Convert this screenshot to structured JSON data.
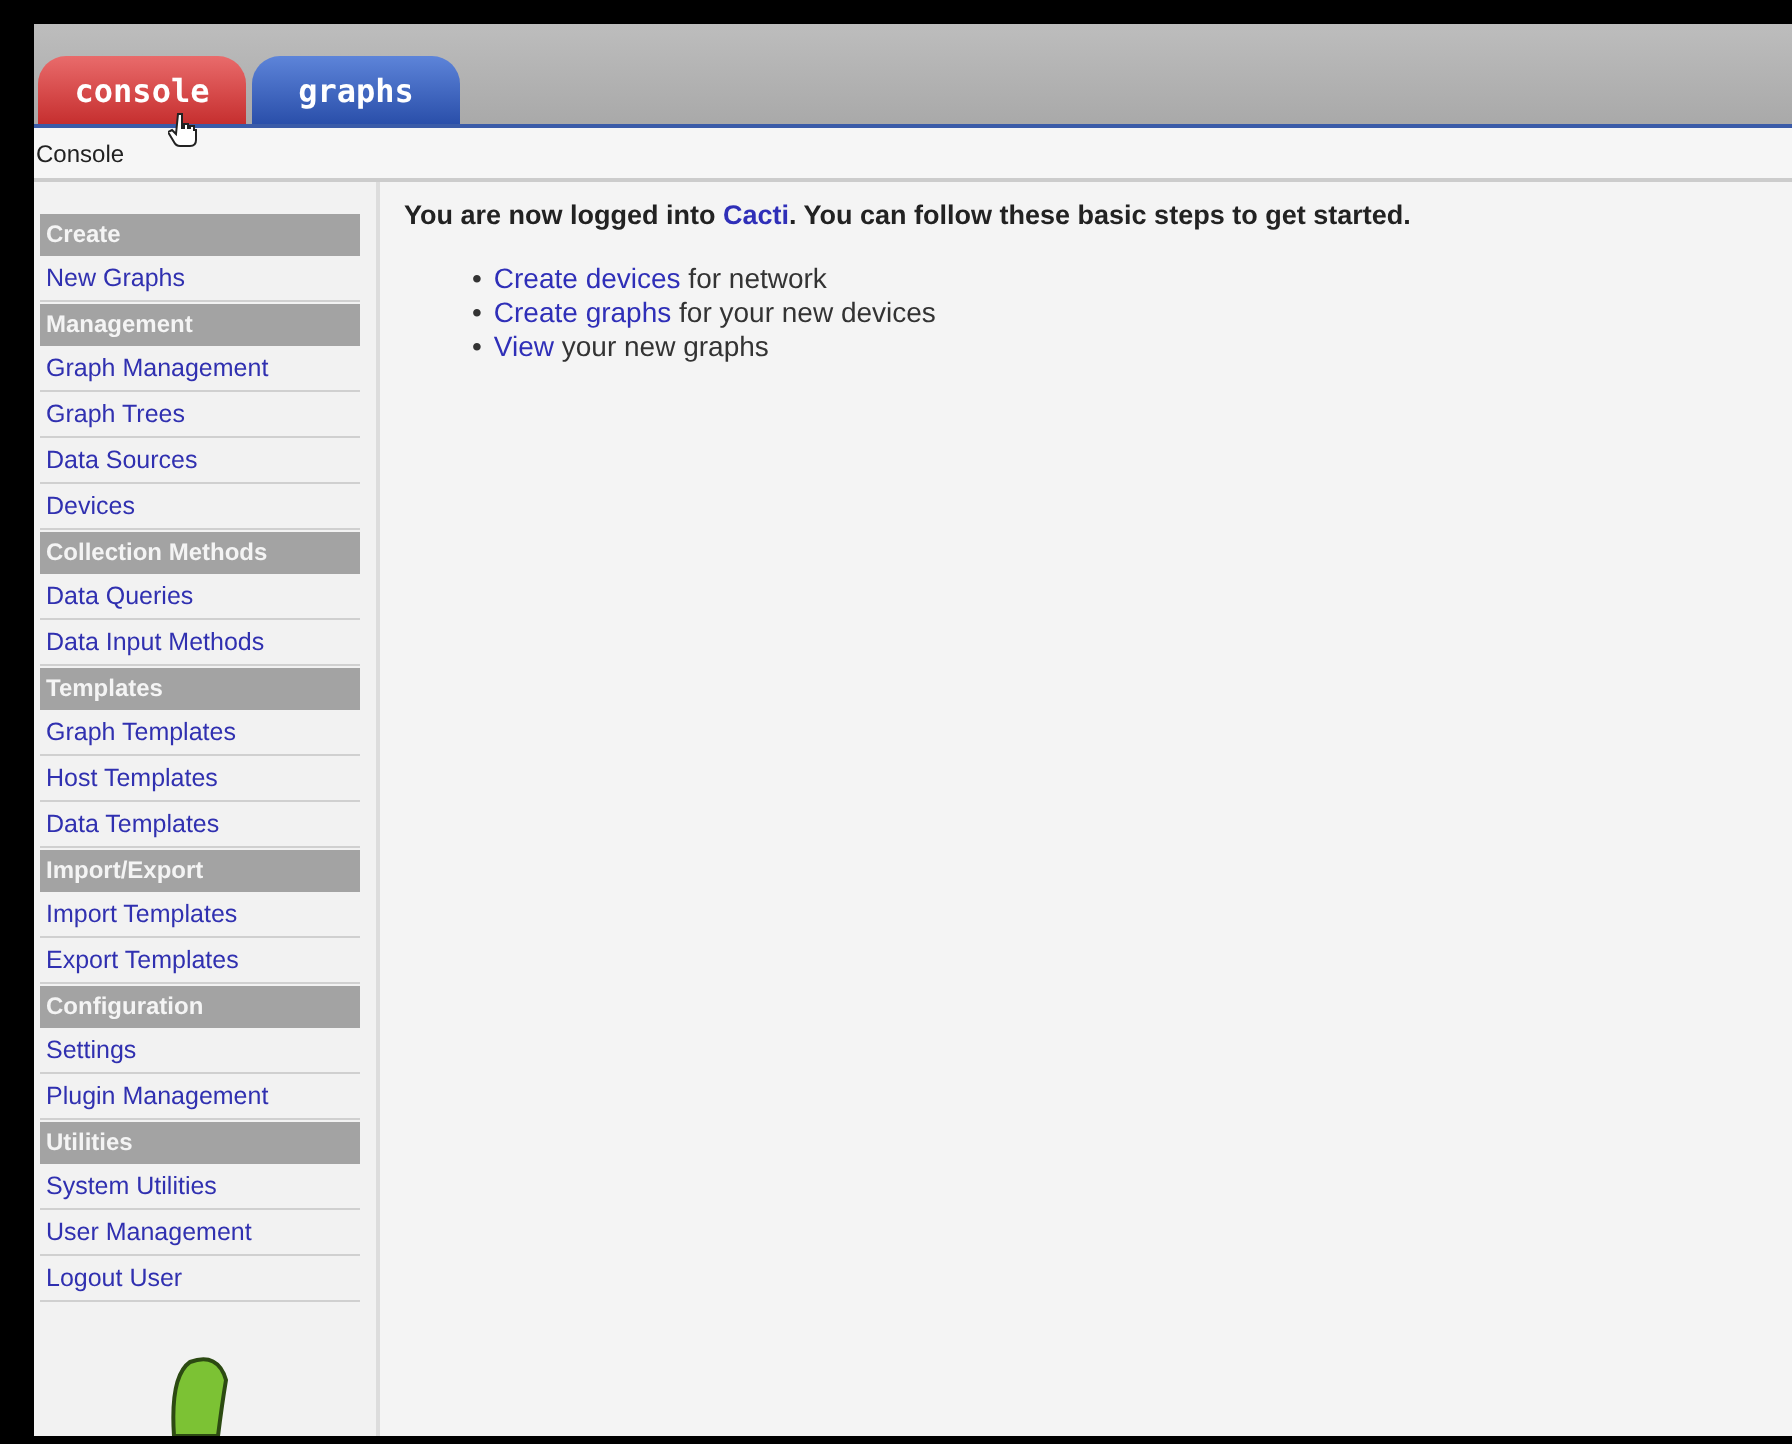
{
  "tabs": [
    {
      "label": "console",
      "selected": true
    },
    {
      "label": "graphs",
      "selected": false
    }
  ],
  "breadcrumb": "Console",
  "sidebar": {
    "sections": [
      {
        "header": "Create",
        "items": [
          "New Graphs"
        ]
      },
      {
        "header": "Management",
        "items": [
          "Graph Management",
          "Graph Trees",
          "Data Sources",
          "Devices"
        ]
      },
      {
        "header": "Collection Methods",
        "items": [
          "Data Queries",
          "Data Input Methods"
        ]
      },
      {
        "header": "Templates",
        "items": [
          "Graph Templates",
          "Host Templates",
          "Data Templates"
        ]
      },
      {
        "header": "Import/Export",
        "items": [
          "Import Templates",
          "Export Templates"
        ]
      },
      {
        "header": "Configuration",
        "items": [
          "Settings",
          "Plugin Management"
        ]
      },
      {
        "header": "Utilities",
        "items": [
          "System Utilities",
          "User Management",
          "Logout User"
        ]
      }
    ]
  },
  "intro": {
    "before": "You are now logged into ",
    "link": "Cacti",
    "after": ". You can follow these basic steps to get started."
  },
  "steps": [
    {
      "marker": "•",
      "link": "Create devices",
      "text": " for network"
    },
    {
      "marker": "•",
      "link": "Create graphs",
      "text": " for your new devices"
    },
    {
      "marker": "•",
      "link": "View",
      "text": " your new graphs"
    }
  ]
}
